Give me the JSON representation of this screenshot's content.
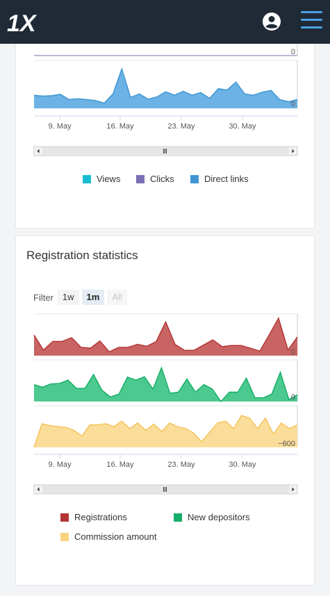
{
  "header": {
    "logo_text": "1X"
  },
  "traffic_chart": {
    "views_axis_max_label": "0",
    "direct_axis_label": "0",
    "x_ticks": [
      "9. May",
      "16. May",
      "23. May",
      "30. May"
    ],
    "legend": [
      {
        "name": "Views",
        "color": "#17bcd1"
      },
      {
        "name": "Clicks",
        "color": "#7a6fb5"
      },
      {
        "name": "Direct links",
        "color": "#3f97d4"
      }
    ],
    "chart_data": {
      "type": "area",
      "series": [
        {
          "name": "Direct links",
          "values": [
            0.3,
            0.28,
            0.29,
            0.32,
            0.2,
            0.22,
            0.2,
            0.18,
            0.12,
            0.33,
            0.9,
            0.25,
            0.33,
            0.21,
            0.26,
            0.38,
            0.3,
            0.39,
            0.3,
            0.36,
            0.23,
            0.45,
            0.42,
            0.6,
            0.33,
            0.3,
            0.37,
            0.41,
            0.2,
            0.15,
            0.2
          ]
        }
      ]
    }
  },
  "registration_card": {
    "title": "Registration statistics",
    "filter": {
      "label": "Filter",
      "options": [
        "1w",
        "1m",
        "All"
      ],
      "active": "1m",
      "disabled": "All"
    },
    "reg_axis_label": "0",
    "dep_axis_label": "0",
    "comm_axis_label": "−600",
    "x_ticks": [
      "9. May",
      "16. May",
      "23. May",
      "30. May"
    ],
    "legend": [
      {
        "name": "Registrations",
        "color": "#b53535"
      },
      {
        "name": "New depositors",
        "color": "#17ae6a"
      },
      {
        "name": "Commission amount",
        "color": "#f9d37f"
      }
    ],
    "chart_data": {
      "type": "area",
      "series": [
        {
          "name": "Registrations",
          "values": [
            0.55,
            0.15,
            0.38,
            0.38,
            0.48,
            0.22,
            0.2,
            0.39,
            0.1,
            0.22,
            0.22,
            0.3,
            0.25,
            0.38,
            0.9,
            0.3,
            0.14,
            0.14,
            0.28,
            0.42,
            0.24,
            0.27,
            0.27,
            0.2,
            0.12,
            0.55,
            1.0,
            0.15,
            0.5
          ]
        },
        {
          "name": "New depositors",
          "values": [
            0.45,
            0.38,
            0.47,
            0.48,
            0.57,
            0.35,
            0.35,
            0.72,
            0.3,
            0.12,
            0.2,
            0.65,
            0.57,
            0.66,
            0.33,
            0.9,
            0.22,
            0.25,
            0.6,
            0.25,
            0.45,
            0.33,
            0.0,
            0.25,
            0.25,
            0.62,
            0.1,
            0.1,
            0.2,
            0.78,
            0.05,
            0.18
          ]
        },
        {
          "name": "Commission amount",
          "values": [
            0.0,
            0.63,
            0.58,
            0.55,
            0.53,
            0.45,
            0.3,
            0.6,
            0.6,
            0.63,
            0.55,
            0.7,
            0.5,
            0.65,
            0.45,
            0.62,
            0.42,
            0.65,
            0.55,
            0.5,
            0.38,
            0.15,
            0.4,
            0.65,
            0.7,
            0.5,
            0.85,
            0.78,
            0.5,
            0.78,
            0.35,
            0.65,
            0.5,
            0.6
          ]
        }
      ]
    }
  }
}
